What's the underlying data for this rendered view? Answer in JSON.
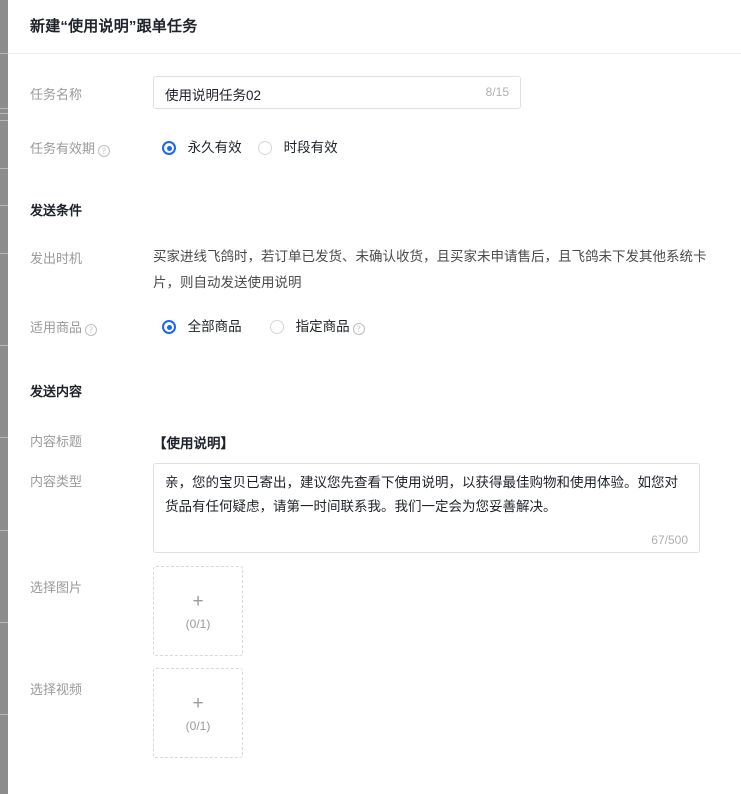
{
  "window": {
    "title": "新建“使用说明”跟单任务"
  },
  "form": {
    "task_name": {
      "label": "任务名称",
      "value": "使用说明任务02",
      "counter": "8/15"
    },
    "validity": {
      "label": "任务有效期",
      "help_icon": "question-mark-icon",
      "options": [
        {
          "label": "永久有效",
          "selected": true
        },
        {
          "label": "时段有效",
          "selected": false
        }
      ]
    },
    "send_condition": {
      "section_title": "发送条件",
      "timing": {
        "label": "发出时机",
        "text": "买家进线飞鸽时，若订单已发货、未确认收货，且买家未申请售后，且飞鸽未下发其他系统卡片，则自动发送使用说明"
      },
      "applicable_goods": {
        "label": "适用商品",
        "help_icon": "question-mark-icon",
        "options": [
          {
            "label": "全部商品",
            "selected": true,
            "has_help": false
          },
          {
            "label": "指定商品",
            "selected": false,
            "has_help": true
          }
        ]
      }
    },
    "send_content": {
      "section_title": "发送内容",
      "content_title": {
        "label": "内容标题",
        "value": "【使用说明】"
      },
      "content_type": {
        "label": "内容类型",
        "value": "亲，您的宝贝已寄出，建议您先查看下使用说明，以获得最佳购物和使用体验。如您对货品有任何疑虑，请第一时间联系我。我们一定会为您妥善解决。",
        "counter": "67/500"
      },
      "image_picker": {
        "label": "选择图片",
        "plus": "+",
        "count": "(0/1)"
      },
      "video_picker": {
        "label": "选择视频",
        "plus": "+",
        "count": "(0/1)"
      }
    }
  },
  "colors": {
    "accent": "#1966ff",
    "label": "#9a9a9a",
    "text": "#1d2129",
    "border": "#e0e0e0",
    "dashed": "#d9d9d9"
  }
}
